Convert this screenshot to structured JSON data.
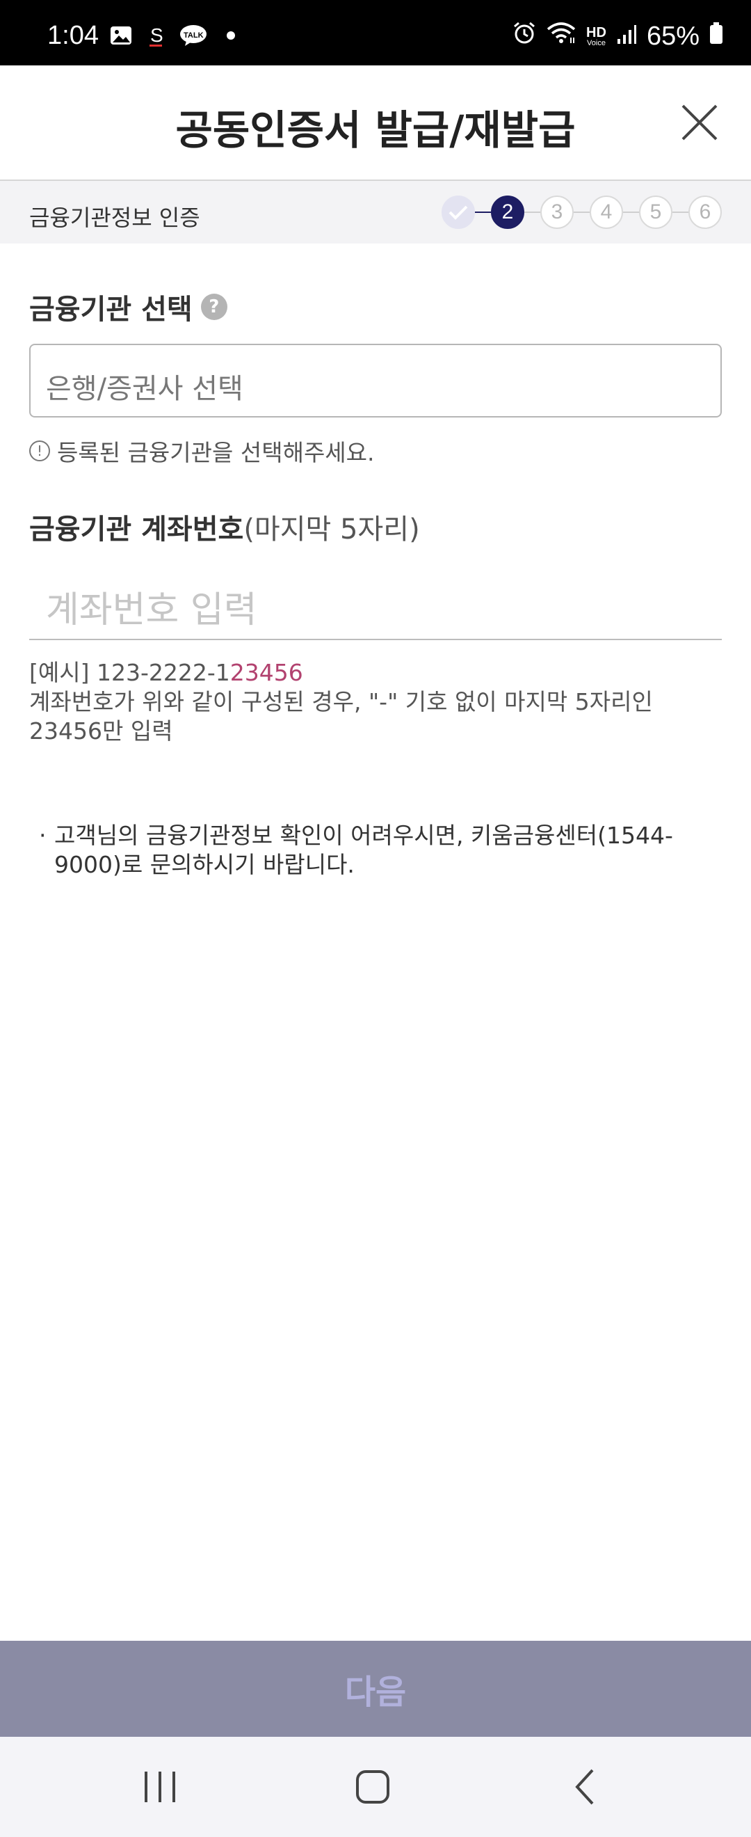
{
  "status_bar": {
    "time": "1:04",
    "battery": "65%",
    "icons": [
      "gallery-icon",
      "s-app-icon",
      "kakaotalk-icon",
      "dot-icon",
      "alarm-icon",
      "wifi-icon",
      "hd-voice-icon",
      "signal-icon",
      "battery-icon"
    ],
    "talk_label": "TALK",
    "hd_label": "HD",
    "voice_label": "Voice"
  },
  "header": {
    "title": "공동인증서 발급/재발급",
    "close_icon": "close-icon"
  },
  "stepper": {
    "label": "금융기관정보 인증",
    "steps": [
      "",
      "2",
      "3",
      "4",
      "5",
      "6"
    ],
    "current": 2
  },
  "institution": {
    "title": "금융기관 선택",
    "help_mark": "?",
    "placeholder": "은행/증권사 선택",
    "hint": "등록된 금융기관을 선택해주세요.",
    "hint_icon": "!"
  },
  "account": {
    "title_bold": "금융기관 계좌번호",
    "title_sub": "(마지막 5자리)",
    "placeholder": "계좌번호 입력",
    "example_prefix": "[예시] 123-2222-1",
    "example_highlight": "23456",
    "example_desc": "계좌번호가 위와 같이 구성된 경우, \"-\" 기호 없이 마지막 5자리인 23456만 입력"
  },
  "notice": {
    "bullet": "·",
    "text": "고객님의 금융기관정보 확인이 어려우시면, 키움금융센터(1544-9000)로 문의하시기 바랍니다."
  },
  "next_button": {
    "label": "다음"
  },
  "colors": {
    "primary": "#1d1d63",
    "highlight": "#b2426f",
    "button_bg": "#8a8ba4",
    "button_text": "#b1b1dc"
  }
}
